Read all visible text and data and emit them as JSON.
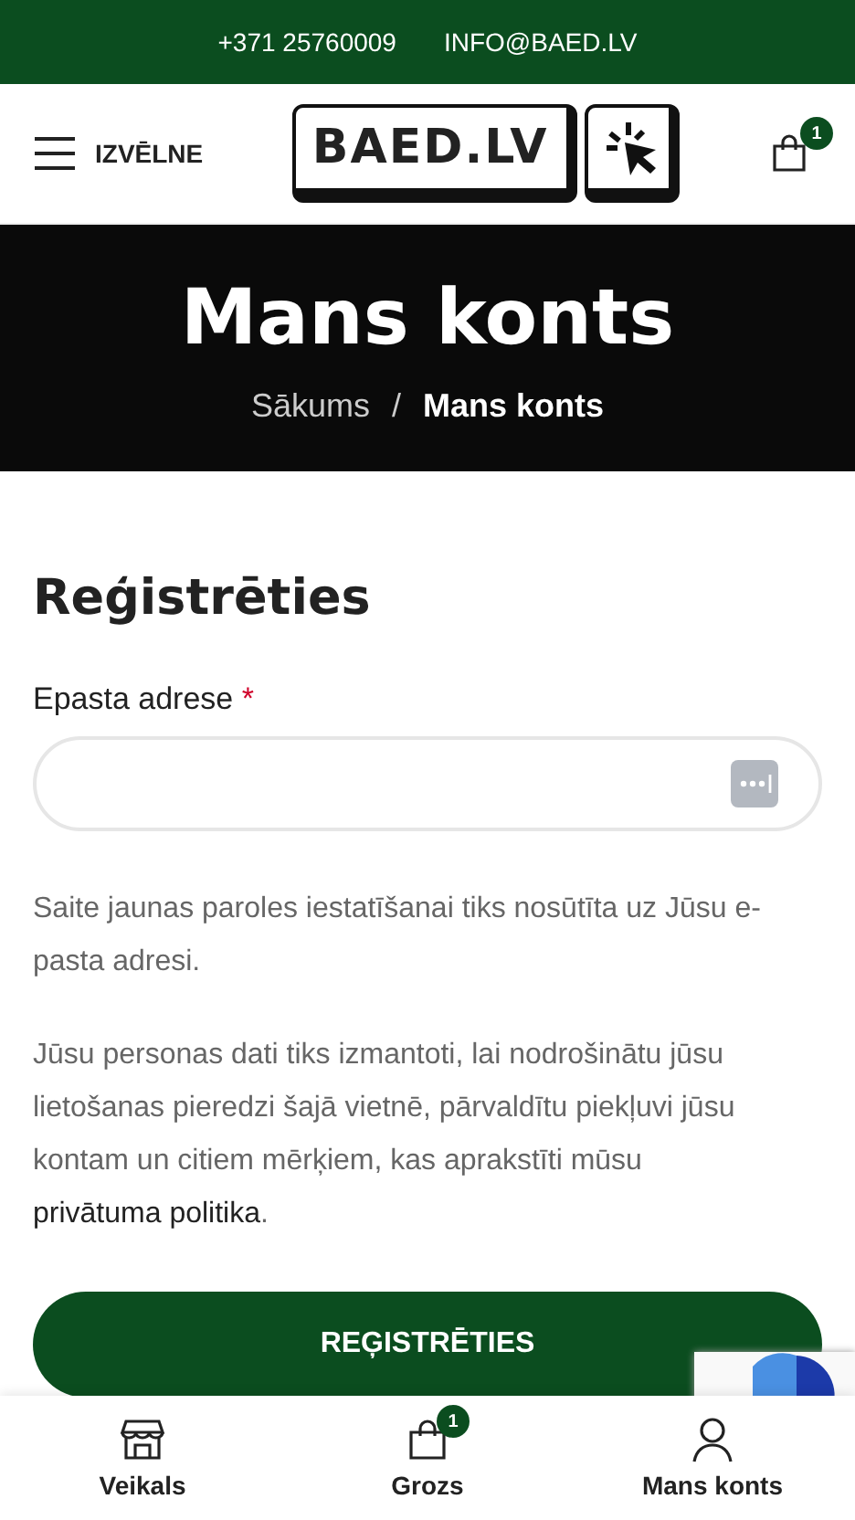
{
  "topbar": {
    "phone": "+371 25760009",
    "email": "INFO@BAED.LV"
  },
  "header": {
    "menu_label": "IZVĒLNE",
    "logo_text": "BAED.LV",
    "cart_count": "1"
  },
  "hero": {
    "title": "Mans konts",
    "breadcrumbs": [
      {
        "label": "Sākums",
        "current": false
      },
      {
        "label": "Mans konts",
        "current": true
      }
    ],
    "separator": "/"
  },
  "form": {
    "title": "Reģistrēties",
    "field": {
      "label": "Epasta adrese",
      "required_mark": "*"
    },
    "notes": [
      {
        "text": "Saite jaunas paroles iestatīšanai tiks nosūtīta uz Jūsu e-pasta adresi."
      },
      {
        "text": "Jūsu personas dati tiks izmantoti, lai nodrošinātu jūsu lietošanas pieredzi šajā vietnē, pārvaldītu piekļuvi jūsu kontam un citiem mērķiem, kas aprakstīti mūsu ",
        "link": "privātuma politika",
        "after": "."
      }
    ],
    "submit": "REĢISTRĒTIES"
  },
  "bottom_nav": [
    {
      "kind": "shop",
      "label": "Veikals"
    },
    {
      "kind": "cart",
      "label": "Grozs",
      "badge": "1"
    },
    {
      "kind": "account",
      "label": "Mans konts"
    }
  ]
}
